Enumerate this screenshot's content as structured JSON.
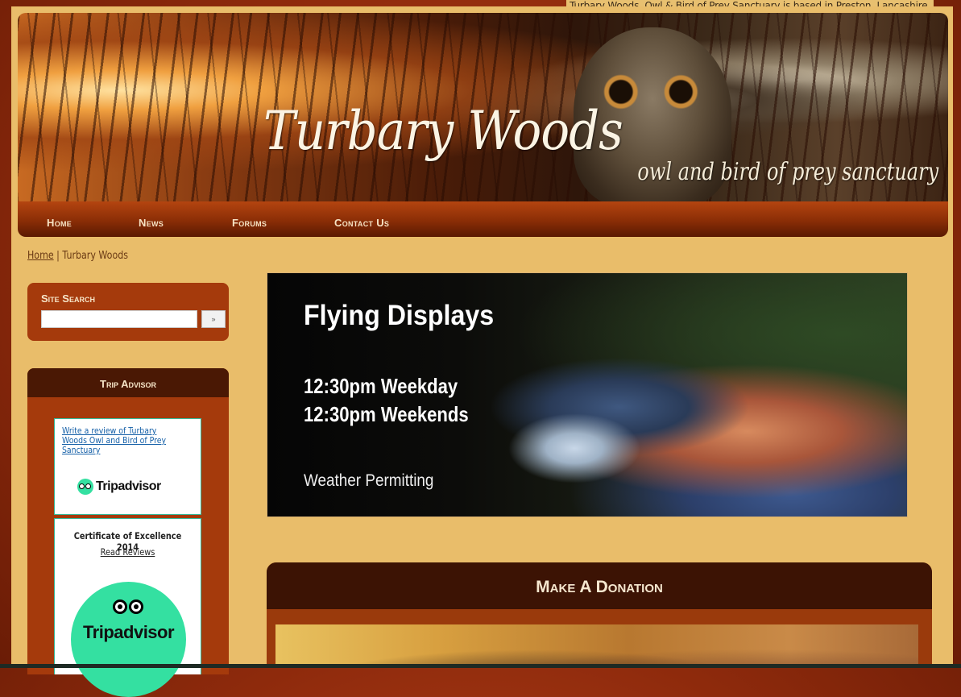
{
  "tagline": "Turbary Woods, Owl & Bird of Prey Sanctuary is based in Preston, Lancashire.",
  "header": {
    "logo_main": "Turbary Woods",
    "logo_sub": "owl and bird of prey sanctuary"
  },
  "nav": [
    {
      "label": "Home"
    },
    {
      "label": "News"
    },
    {
      "label": "Forums"
    },
    {
      "label": "Contact Us"
    }
  ],
  "breadcrumb": {
    "home": "Home",
    "separator": "|",
    "current": "Turbary Woods"
  },
  "search": {
    "title": "Site Search",
    "placeholder": "",
    "button": "»"
  },
  "tripadvisor": {
    "title": "Trip Advisor",
    "review_link": "Write a review of Turbary Woods Owl and Bird of Prey Sanctuary",
    "logo_text": "Tripadvisor",
    "certificate": "Certificate of Excellence 2014",
    "read_reviews": "Read Reviews",
    "badge_text": "Tripadvisor",
    "brand_color": "#34e0a1"
  },
  "banner": {
    "title": "Flying Displays",
    "weekday": "12:30pm Weekday",
    "weekends": "12:30pm Weekends",
    "note": "Weather Permitting"
  },
  "donation": {
    "title": "Make A Donation"
  },
  "colors": {
    "accent": "#a53a0c",
    "page_bg": "#e9bd6a",
    "nav_dark": "#5a1a02"
  }
}
